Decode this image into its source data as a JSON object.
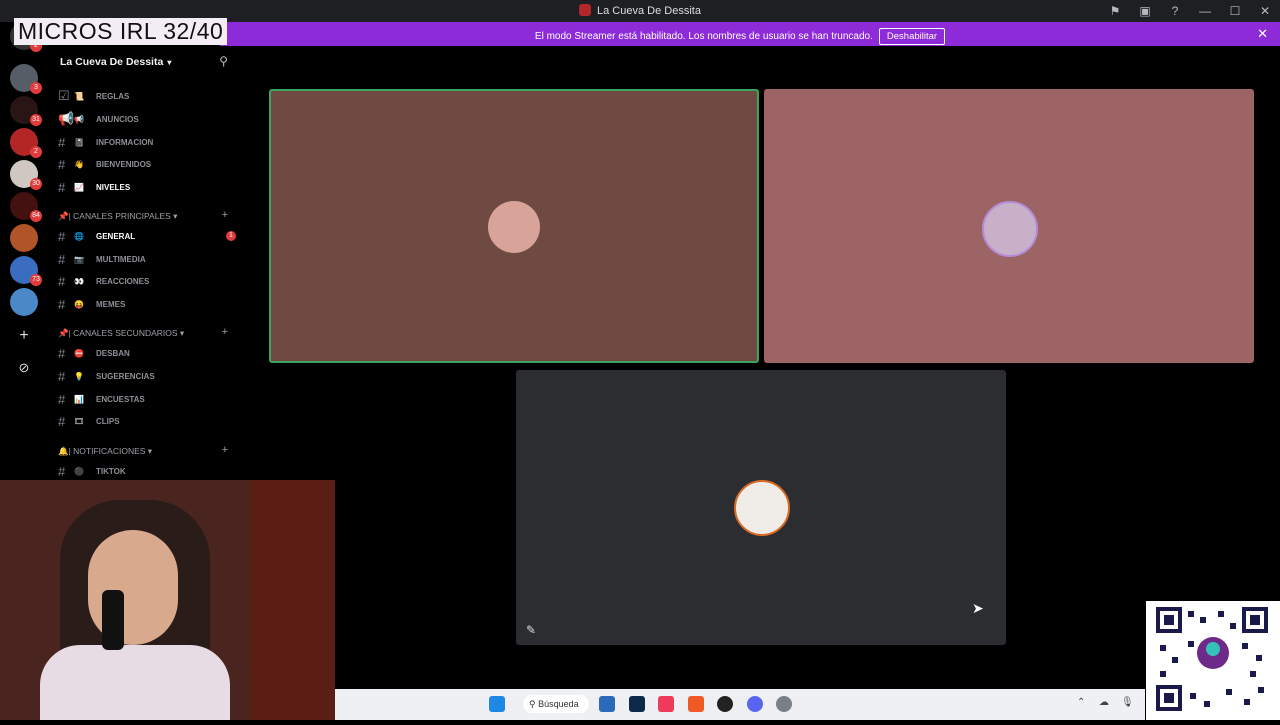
{
  "overlay_text": "MICROS IRL 32/40",
  "window": {
    "title": "La Cueva De Dessita"
  },
  "banner": {
    "message": "El modo Streamer está habilitado. Los nombres de usuario se han truncado.",
    "button_label": "Deshabilitar"
  },
  "server": {
    "name": "La Cueva De Dessita"
  },
  "channels_top": [
    {
      "label": "REGLAS"
    },
    {
      "label": "ANUNCIOS"
    },
    {
      "label": "INFORMACION"
    },
    {
      "label": "BIENVENIDOS"
    },
    {
      "label": "NIVELES"
    }
  ],
  "categories": [
    {
      "label": "| CANALES PRINCIPALES"
    },
    {
      "label": "| CANALES SECUNDARIOS"
    },
    {
      "label": "| NOTIFICACIONES"
    }
  ],
  "channels_main": [
    {
      "label": "GENERAL",
      "badge": "1"
    },
    {
      "label": "MULTIMEDIA"
    },
    {
      "label": "REACCIONES"
    },
    {
      "label": "MEMES"
    }
  ],
  "channels_secondary": [
    {
      "label": "DESBAN"
    },
    {
      "label": "SUGERENCIAS"
    },
    {
      "label": "ENCUESTAS"
    },
    {
      "label": "CLIPS"
    }
  ],
  "channels_notif": [
    {
      "label": "TIKTOK"
    }
  ],
  "server_badges": [
    "2",
    "3",
    "31",
    "2",
    "30",
    "84",
    "73"
  ],
  "taskbar": {
    "search_label": "Búsqueda"
  },
  "colors": {
    "streamer_banner": "#8e2bd8",
    "tile1": "#6e4a42",
    "tile2": "#9c6464",
    "tile3": "#2b2d31",
    "speaking_border": "#3ba55d"
  }
}
